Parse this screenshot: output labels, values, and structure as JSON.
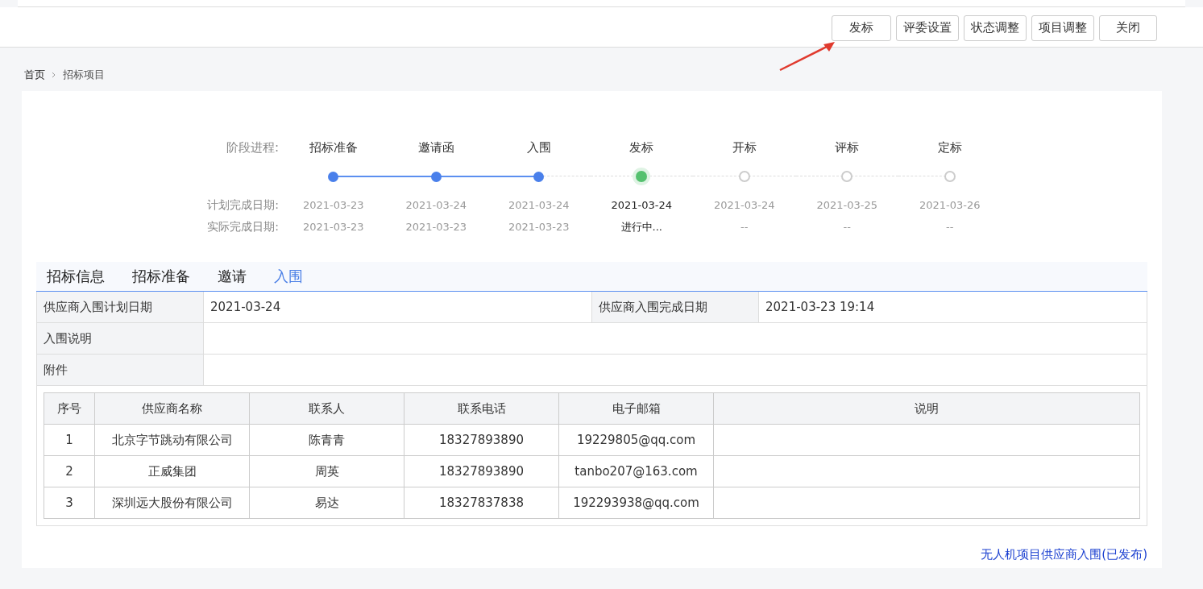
{
  "toolbar": {
    "buttons": [
      {
        "label": "发标"
      },
      {
        "label": "评委设置"
      },
      {
        "label": "状态调整"
      },
      {
        "label": "项目调整"
      },
      {
        "label": "关闭"
      }
    ]
  },
  "breadcrumb": [
    {
      "label": "首页"
    },
    {
      "label": "招标项目"
    }
  ],
  "progress": {
    "label": "阶段进程:",
    "plan_label": "计划完成日期:",
    "actual_label": "实际完成日期:",
    "steps": [
      {
        "name": "招标准备",
        "done": true,
        "current": false,
        "plan": "2021-03-23",
        "actual": "2021-03-23"
      },
      {
        "name": "邀请函",
        "done": true,
        "current": false,
        "plan": "2021-03-24",
        "actual": "2021-03-23"
      },
      {
        "name": "入围",
        "done": true,
        "current": false,
        "plan": "2021-03-24",
        "actual": "2021-03-23"
      },
      {
        "name": "发标",
        "done": false,
        "current": true,
        "plan": "2021-03-24",
        "actual": "进行中..."
      },
      {
        "name": "开标",
        "done": false,
        "current": false,
        "plan": "2021-03-24",
        "actual": "--"
      },
      {
        "name": "评标",
        "done": false,
        "current": false,
        "plan": "2021-03-25",
        "actual": "--"
      },
      {
        "name": "定标",
        "done": false,
        "current": false,
        "plan": "2021-03-26",
        "actual": "--"
      }
    ]
  },
  "tabs": [
    {
      "label": "招标信息",
      "selected": false
    },
    {
      "label": "招标准备",
      "selected": false
    },
    {
      "label": "邀请",
      "selected": false
    },
    {
      "label": "入围",
      "selected": true
    }
  ],
  "form": {
    "plan_date_label": "供应商入围计划日期",
    "plan_date": "2021-03-24",
    "done_date_label": "供应商入围完成日期",
    "done_date": "2021-03-23 19:14",
    "note_label": "入围说明",
    "attach_label": "附件"
  },
  "table": {
    "columns": [
      "序号",
      "供应商名称",
      "联系人",
      "联系电话",
      "电子邮箱",
      "说明"
    ],
    "rows": [
      [
        "1",
        "北京字节跳动有限公司",
        "陈青青",
        "18327893890",
        "19229805@qq.com"
      ],
      [
        "2",
        "正威集团",
        "周英",
        "18327893890",
        "tanbo207@163.com"
      ],
      [
        "3",
        "深圳远大股份有限公司",
        "易达",
        "18327837838",
        "192293938@qq.com"
      ]
    ]
  },
  "footer_link": "无人机项目供应商入围(已发布)"
}
